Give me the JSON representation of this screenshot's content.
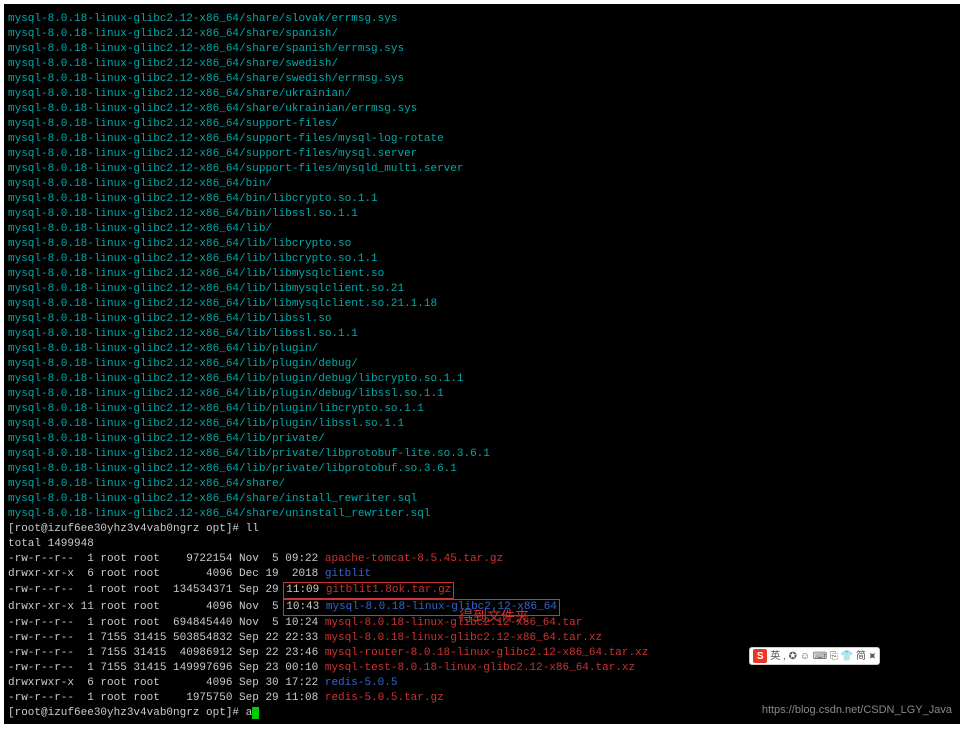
{
  "file_lines": [
    "mysql-8.0.18-linux-glibc2.12-x86_64/share/slovak/errmsg.sys",
    "mysql-8.0.18-linux-glibc2.12-x86_64/share/spanish/",
    "mysql-8.0.18-linux-glibc2.12-x86_64/share/spanish/errmsg.sys",
    "mysql-8.0.18-linux-glibc2.12-x86_64/share/swedish/",
    "mysql-8.0.18-linux-glibc2.12-x86_64/share/swedish/errmsg.sys",
    "mysql-8.0.18-linux-glibc2.12-x86_64/share/ukrainian/",
    "mysql-8.0.18-linux-glibc2.12-x86_64/share/ukrainian/errmsg.sys",
    "mysql-8.0.18-linux-glibc2.12-x86_64/support-files/",
    "mysql-8.0.18-linux-glibc2.12-x86_64/support-files/mysql-log-rotate",
    "mysql-8.0.18-linux-glibc2.12-x86_64/support-files/mysql.server",
    "mysql-8.0.18-linux-glibc2.12-x86_64/support-files/mysqld_multi.server",
    "mysql-8.0.18-linux-glibc2.12-x86_64/bin/",
    "mysql-8.0.18-linux-glibc2.12-x86_64/bin/libcrypto.so.1.1",
    "mysql-8.0.18-linux-glibc2.12-x86_64/bin/libssl.so.1.1",
    "mysql-8.0.18-linux-glibc2.12-x86_64/lib/",
    "mysql-8.0.18-linux-glibc2.12-x86_64/lib/libcrypto.so",
    "mysql-8.0.18-linux-glibc2.12-x86_64/lib/libcrypto.so.1.1",
    "mysql-8.0.18-linux-glibc2.12-x86_64/lib/libmysqlclient.so",
    "mysql-8.0.18-linux-glibc2.12-x86_64/lib/libmysqlclient.so.21",
    "mysql-8.0.18-linux-glibc2.12-x86_64/lib/libmysqlclient.so.21.1.18",
    "mysql-8.0.18-linux-glibc2.12-x86_64/lib/libssl.so",
    "mysql-8.0.18-linux-glibc2.12-x86_64/lib/libssl.so.1.1",
    "mysql-8.0.18-linux-glibc2.12-x86_64/lib/plugin/",
    "mysql-8.0.18-linux-glibc2.12-x86_64/lib/plugin/debug/",
    "mysql-8.0.18-linux-glibc2.12-x86_64/lib/plugin/debug/libcrypto.so.1.1",
    "mysql-8.0.18-linux-glibc2.12-x86_64/lib/plugin/debug/libssl.so.1.1",
    "mysql-8.0.18-linux-glibc2.12-x86_64/lib/plugin/libcrypto.so.1.1",
    "mysql-8.0.18-linux-glibc2.12-x86_64/lib/plugin/libssl.so.1.1",
    "mysql-8.0.18-linux-glibc2.12-x86_64/lib/private/",
    "mysql-8.0.18-linux-glibc2.12-x86_64/lib/private/libprotobuf-lite.so.3.6.1",
    "mysql-8.0.18-linux-glibc2.12-x86_64/lib/private/libprotobuf.so.3.6.1",
    "mysql-8.0.18-linux-glibc2.12-x86_64/share/",
    "mysql-8.0.18-linux-glibc2.12-x86_64/share/install_rewriter.sql",
    "mysql-8.0.18-linux-glibc2.12-x86_64/share/uninstall_rewriter.sql"
  ],
  "prompt1": {
    "user_host": "[root@izuf6ee30yhz3v4vab0ngrz opt]# ",
    "cmd": "ll",
    "total": "total 1499948"
  },
  "ls_rows": [
    {
      "meta": "-rw-r--r--  1 root root    9722154 Nov  5 09:22 ",
      "name": "apache-tomcat-8.5.45.tar.gz",
      "cls": "name-red",
      "hl": false
    },
    {
      "meta": "drwxr-xr-x  6 root root       4096 Dec 19  2018 ",
      "name": "gitblit",
      "cls": "name-blue",
      "hl": false
    },
    {
      "meta": "-rw-r--r--  1 root root  134534371 Sep 29 ",
      "time": "11:09 ",
      "name": "gitblit1.8ok.tar.gz",
      "cls": "name-red",
      "hl": true,
      "hlTime": true
    },
    {
      "meta": "drwxr-xr-x 11 root root       4096 Nov  5 ",
      "time": "10:43 ",
      "name": "mysql-8.0.18-linux-glibc2.12-x86_64",
      "cls": "name-blue",
      "hl": true,
      "hlTime": true
    },
    {
      "meta": "-rw-r--r--  1 root root  694845440 Nov  5 10:24 ",
      "name": "mysql-8.0.18-linux-glibc2.12-x86_64.tar",
      "cls": "name-red",
      "hl": false
    },
    {
      "meta": "-rw-r--r--  1 7155 31415 503854832 Sep 22 22:33 ",
      "name": "mysql-8.0.18-linux-glibc2.12-x86_64.tar.xz",
      "cls": "name-red",
      "hl": false
    },
    {
      "meta": "-rw-r--r--  1 7155 31415  40986912 Sep 22 23:46 ",
      "name": "mysql-router-8.0.18-linux-glibc2.12-x86_64.tar.xz",
      "cls": "name-red",
      "hl": false
    },
    {
      "meta": "-rw-r--r--  1 7155 31415 149997696 Sep 23 00:10 ",
      "name": "mysql-test-8.0.18-linux-glibc2.12-x86_64.tar.xz",
      "cls": "name-red",
      "hl": false
    },
    {
      "meta": "drwxrwxr-x  6 root root       4096 Sep 30 17:22 ",
      "name": "redis-5.0.5",
      "cls": "name-blue",
      "hl": false
    },
    {
      "meta": "-rw-r--r--  1 root root    1975750 Sep 29 11:08 ",
      "name": "redis-5.0.5.tar.gz",
      "cls": "name-red",
      "hl": false
    }
  ],
  "prompt2": {
    "user_host": "[root@izuf6ee30yhz3v4vab0ngrz opt]# ",
    "cmd": "a"
  },
  "annotation": "得到文件夹",
  "watermark": "https://blog.csdn.net/CSDN_LGY_Java",
  "ime": {
    "logo": "S",
    "items": [
      "英",
      ",",
      "✪",
      "☺",
      "⌨",
      "⎘",
      "👕",
      "简",
      "⯍"
    ]
  }
}
